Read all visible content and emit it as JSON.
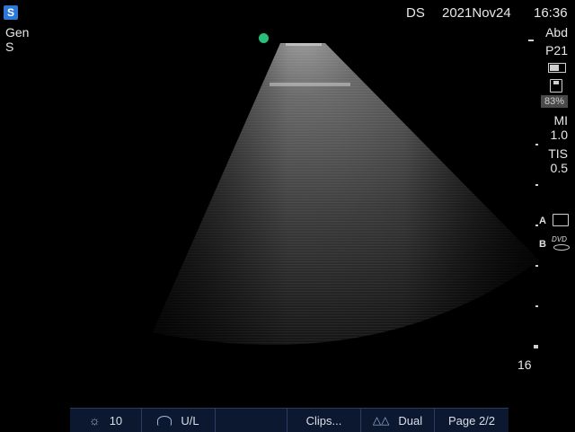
{
  "header": {
    "logo_glyph": "S",
    "operator": "DS",
    "date": "2021Nov24",
    "time": "16:36"
  },
  "left": {
    "preset": "Gen",
    "mode": "S"
  },
  "right": {
    "exam": "Abd",
    "probe": "P21",
    "storage_pct": "83%",
    "mi_label": "MI",
    "mi_value": "1.0",
    "tis_label": "TIS",
    "tis_value": "0.5",
    "printer_a": "A",
    "printer_b": "B",
    "dvd": "DVD",
    "depth": "16"
  },
  "bottombar": {
    "gain_value": "10",
    "orientation": "U/L",
    "clips": "Clips...",
    "dual": "Dual",
    "page": "Page 2/2"
  },
  "icons": {
    "logo": "logo-icon",
    "battery": "battery-icon",
    "save": "save-icon",
    "printer": "printer-icon",
    "dvd": "dvd-icon",
    "gain": "gain-icon",
    "probe": "probe-icon",
    "dual": "dual-icon"
  },
  "colors": {
    "orientation_marker": "#27c07a",
    "bar_bg": "#0c1830"
  }
}
